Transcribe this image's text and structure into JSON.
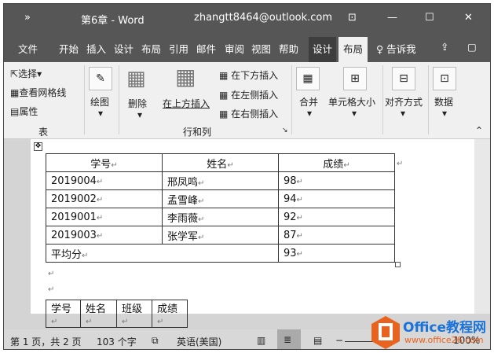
{
  "title": {
    "quick_access": "»",
    "doc_title": "第6章 - Word",
    "account": "zhangtt8464@outlook.com",
    "ribbon_display": "⊡",
    "minimize": "—",
    "maximize": "☐",
    "close": "✕"
  },
  "tabs": [
    "文件",
    "开始",
    "插入",
    "设计",
    "布局",
    "引用",
    "邮件",
    "审阅",
    "视图",
    "帮助",
    "设计",
    "布局"
  ],
  "tell_me": "告诉我",
  "ribbon": {
    "select": "选择",
    "view_gridlines": "查看网格线",
    "properties": "属性",
    "group_table": "表",
    "draw": "绘图",
    "delete": "删除",
    "insert_above": "在上方插入",
    "insert_below": "在下方插入",
    "insert_left": "在左侧插入",
    "insert_right": "在右侧插入",
    "group_rows_cols": "行和列",
    "merge": "合并",
    "cell_size": "单元格大小",
    "alignment": "对齐方式",
    "data": "数据"
  },
  "table1": {
    "headers": [
      "学号",
      "姓名",
      "成绩"
    ],
    "rows": [
      [
        "2019004",
        "邢凤鸣",
        "98"
      ],
      [
        "2019002",
        "孟雪峰",
        "94"
      ],
      [
        "2019001",
        "李雨薇",
        "92"
      ],
      [
        "2019003",
        "张学军",
        "87"
      ]
    ],
    "footer_label": "平均分",
    "footer_value": "93"
  },
  "table2": {
    "headers": [
      "学号",
      "姓名",
      "班级",
      "成绩"
    ]
  },
  "status": {
    "page": "第 1 页，共 2 页",
    "words": "103 个字",
    "language": "英语(美国)",
    "zoom": "100%"
  },
  "watermark": {
    "name": "Office教程网",
    "url": "www.office26.com"
  }
}
